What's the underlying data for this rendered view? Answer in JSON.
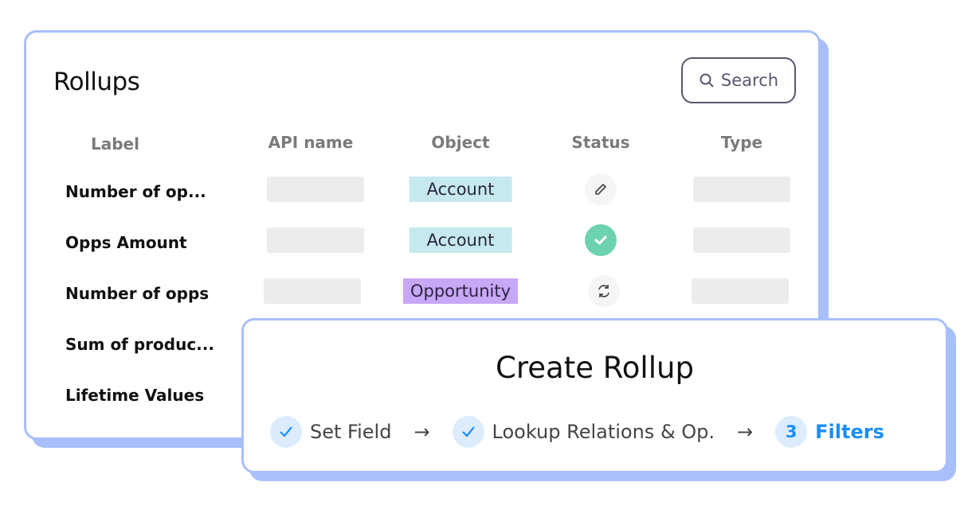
{
  "rollups": {
    "title": "Rollups",
    "search_label": "Search",
    "columns": [
      "Label",
      "API name",
      "Object",
      "Status",
      "Type"
    ],
    "rows": [
      {
        "label": "Number of op...",
        "object": "Account",
        "status": "edit"
      },
      {
        "label": "Opps Amount",
        "object": "Account",
        "status": "success"
      },
      {
        "label": "Number of opps",
        "object": "Opportunity",
        "status": "syncing"
      },
      {
        "label": "Sum of produc..."
      },
      {
        "label": "Lifetime Values"
      }
    ]
  },
  "create": {
    "title": "Create Rollup",
    "steps": [
      {
        "label": "Set Field",
        "state": "done"
      },
      {
        "label": "Lookup Relations & Op.",
        "state": "done"
      },
      {
        "number": "3",
        "label": "Filters",
        "state": "active"
      }
    ]
  },
  "colors": {
    "accent": "#1a8ef5",
    "account": "#c5e9ef",
    "opportunity": "#c9a7f7",
    "success": "#6dd3ae",
    "border": "#a9bffc"
  }
}
